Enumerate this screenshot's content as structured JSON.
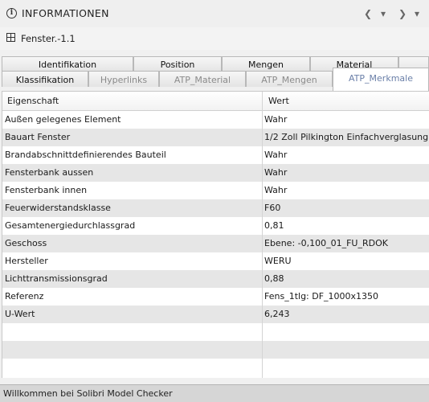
{
  "panel": {
    "title": "INFORMATIONEN",
    "nav": {
      "prev": "❮",
      "menu1": "▾",
      "next": "❯",
      "menu2": "▾"
    }
  },
  "element": {
    "name": "Fenster.-1.1",
    "icon": "grid-window-icon"
  },
  "tabs": {
    "row_back": [
      "Identifikation",
      "Position",
      "Mengen",
      "Material"
    ],
    "row_front": [
      "Klassifikation",
      "Hyperlinks",
      "ATP_Material",
      "ATP_Mengen",
      "ATP_Merkmale"
    ],
    "active": "ATP_Merkmale"
  },
  "table": {
    "headers": [
      "Eigenschaft",
      "Wert"
    ],
    "rows": [
      {
        "key": "Außen gelegenes Element",
        "value": "Wahr"
      },
      {
        "key": "Bauart Fenster",
        "value": "1/2 Zoll Pilkington Einfachverglasung"
      },
      {
        "key": "Brandabschnittdefinierendes Bauteil",
        "value": "Wahr"
      },
      {
        "key": "Fensterbank aussen",
        "value": "Wahr"
      },
      {
        "key": "Fensterbank innen",
        "value": "Wahr"
      },
      {
        "key": "Feuerwiderstandsklasse",
        "value": "F60"
      },
      {
        "key": "Gesamtenergiedurchlassgrad",
        "value": "0,81"
      },
      {
        "key": "Geschoss",
        "value": "Ebene: -0,100_01_FU_RDOK"
      },
      {
        "key": "Hersteller",
        "value": "WERU"
      },
      {
        "key": "Lichttransmissionsgrad",
        "value": "0,88"
      },
      {
        "key": "Referenz",
        "value": "Fens_1tlg: DF_1000x1350"
      },
      {
        "key": "U-Wert",
        "value": "6,243"
      }
    ]
  },
  "status": {
    "text": "Willkommen bei Solibri Model Checker"
  },
  "colors": {
    "active_tab_text": "#6a7fa8",
    "row_shade": "#e6e6e6",
    "status_bar": "#d6d6d6"
  }
}
